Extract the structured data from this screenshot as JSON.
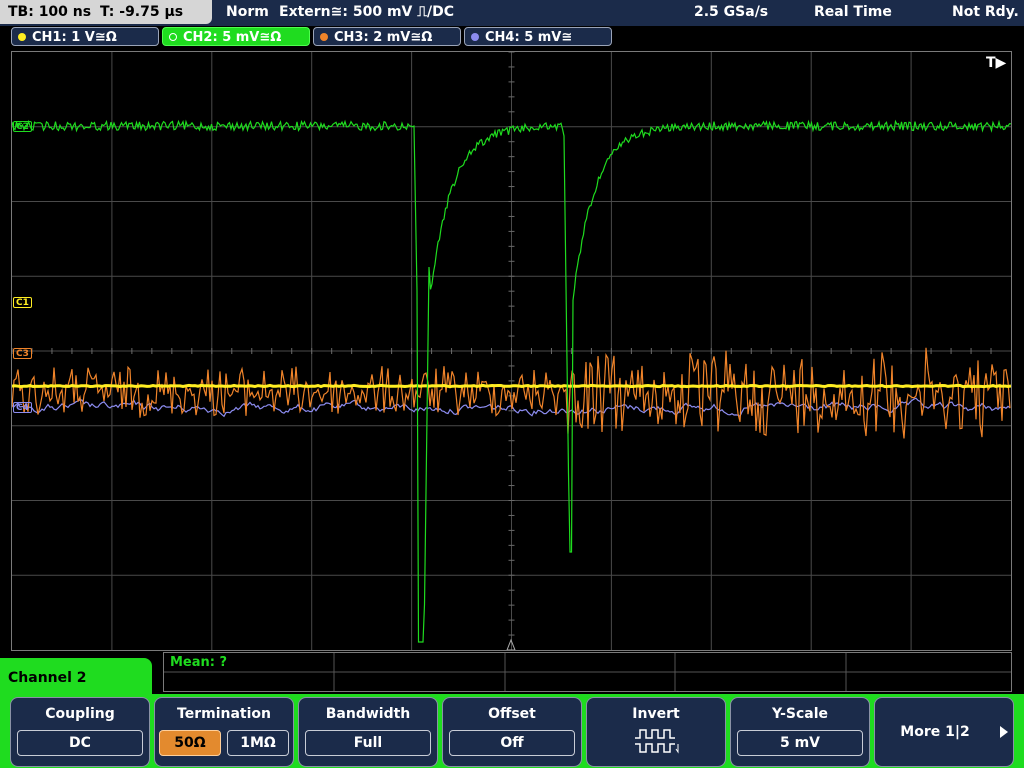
{
  "topbar": {
    "timebase": "TB: 100 ns",
    "trigger_time": "T: -9.75 µs",
    "mode": "Norm",
    "trigger_source": "Extern≅: 500 mV ⎍/DC",
    "sample_rate": "2.5 GSa/s",
    "acq_mode": "Real Time",
    "status": "Not Rdy."
  },
  "channels": [
    {
      "label": "CH1: 1 V≅Ω",
      "color": "#ffee22",
      "active": false
    },
    {
      "label": "CH2: 5 mV≅Ω",
      "color": "#1fdc1f",
      "active": true
    },
    {
      "label": "CH3: 2 mV≅Ω",
      "color": "#f0842a",
      "active": false
    },
    {
      "label": "CH4: 5 mV≅",
      "color": "#8c8cf0",
      "active": false
    }
  ],
  "markers": {
    "trigger": "T▶",
    "ch1": "C1",
    "ch2": "C2",
    "ch3": "C3",
    "ch4": "C4"
  },
  "measurement": {
    "label": "Mean: ?"
  },
  "menu": {
    "title": "Channel 2",
    "softkeys": {
      "coupling": {
        "title": "Coupling",
        "value": "DC"
      },
      "termination": {
        "title": "Termination",
        "option1": "50Ω",
        "option2": "1MΩ",
        "selected": "50Ω"
      },
      "bandwidth": {
        "title": "Bandwidth",
        "value": "Full"
      },
      "offset": {
        "title": "Offset",
        "value": "Off"
      },
      "invert": {
        "title": "Invert",
        "icon": "square-wave-invert-icon"
      },
      "yscale": {
        "title": "Y-Scale",
        "value": "5 mV"
      },
      "more": {
        "title": "More 1|2",
        "icon": "arrow-right-icon"
      }
    }
  },
  "colors": {
    "accent_green": "#1fdc1f",
    "panel_navy": "#1b2b4a",
    "ch1": "#ffee22",
    "ch2": "#1fdc1f",
    "ch3": "#f0842a",
    "ch4": "#8c8cf0"
  }
}
